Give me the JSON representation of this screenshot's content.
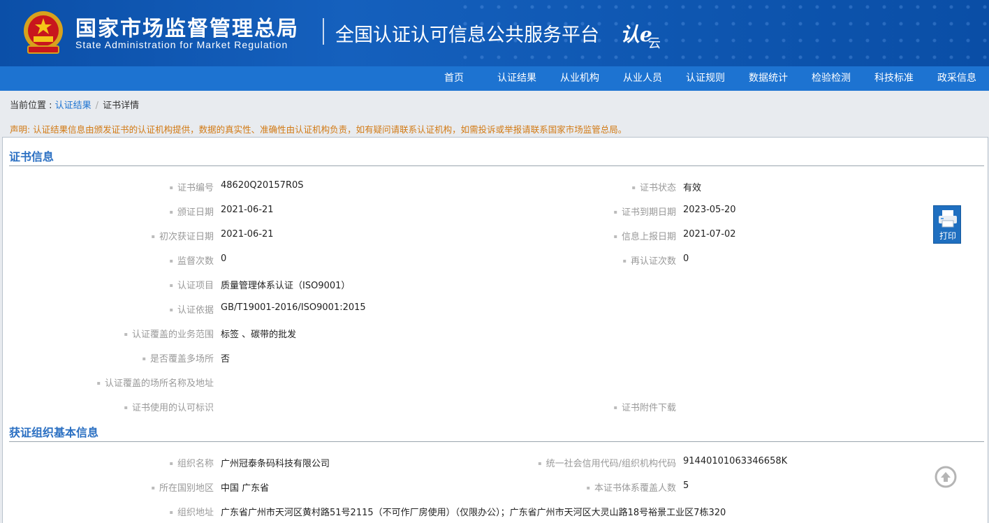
{
  "header": {
    "agency_cn": "国家市场监督管理总局",
    "agency_en": "State Administration  for  Market Regulation",
    "platform": "全国认证认可信息公共服务平台",
    "logo_ren": "认e",
    "logo_yun": "云"
  },
  "nav": [
    "首页",
    "认证结果",
    "从业机构",
    "从业人员",
    "认证规则",
    "数据统计",
    "检验检测",
    "科技标准",
    "政采信息"
  ],
  "breadcrumb": {
    "prefix": "当前位置 : ",
    "link": "认证结果",
    "current": "证书详情"
  },
  "notice": "声明: 认证结果信息由颁发证书的认证机构提供，数据的真实性、准确性由认证机构负责，如有疑问请联系认证机构，如需投诉或举报请联系国家市场监管总局。",
  "cert": {
    "title": "证书信息",
    "cert_no_label": "证书编号",
    "cert_no": "48620Q20157R0S",
    "status_label": "证书状态",
    "status": "有效",
    "issue_date_label": "颁证日期",
    "issue_date": "2021-06-21",
    "expire_label": "证书到期日期",
    "expire_date": "2023-05-20",
    "first_date_label": "初次获证日期",
    "first_date": "2021-06-21",
    "report_label": "信息上报日期",
    "report_date": "2021-07-02",
    "supervise_label": "监督次数",
    "supervise": "0",
    "recert_label": "再认证次数",
    "recert": "0",
    "project_label": "认证项目",
    "project": "质量管理体系认证（ISO9001）",
    "basis_label": "认证依据",
    "basis": "GB/T19001-2016/ISO9001:2015",
    "scope_label": "认证覆盖的业务范围",
    "scope": "标签 、碳带的批发",
    "multi_label": "是否覆盖多场所",
    "multi": "否",
    "sites_label": "认证覆盖的场所名称及地址",
    "mark_label": "证书使用的认可标识",
    "attach_label": "证书附件下载"
  },
  "org": {
    "title": "获证组织基本信息",
    "name_label": "组织名称",
    "name": "广州冠泰条码科技有限公司",
    "code_label": "统一社会信用代码/组织机构代码",
    "code": "91440101063346658K",
    "region_label": "所在国别地区",
    "region": "中国 广东省",
    "people_label": "本证书体系覆盖人数",
    "people": "5",
    "address_label": "组织地址",
    "address": "广东省广州市天河区黄村路51号2115（不可作厂房使用）（仅限办公）；广东省广州市天河区大灵山路18号裕景工业区7栋320"
  },
  "print_label": "打印",
  "colors": {
    "banner": "#0e56b0",
    "nav": "#1d73d1",
    "section": "#2a6fc2",
    "notice": "#d27a14"
  }
}
